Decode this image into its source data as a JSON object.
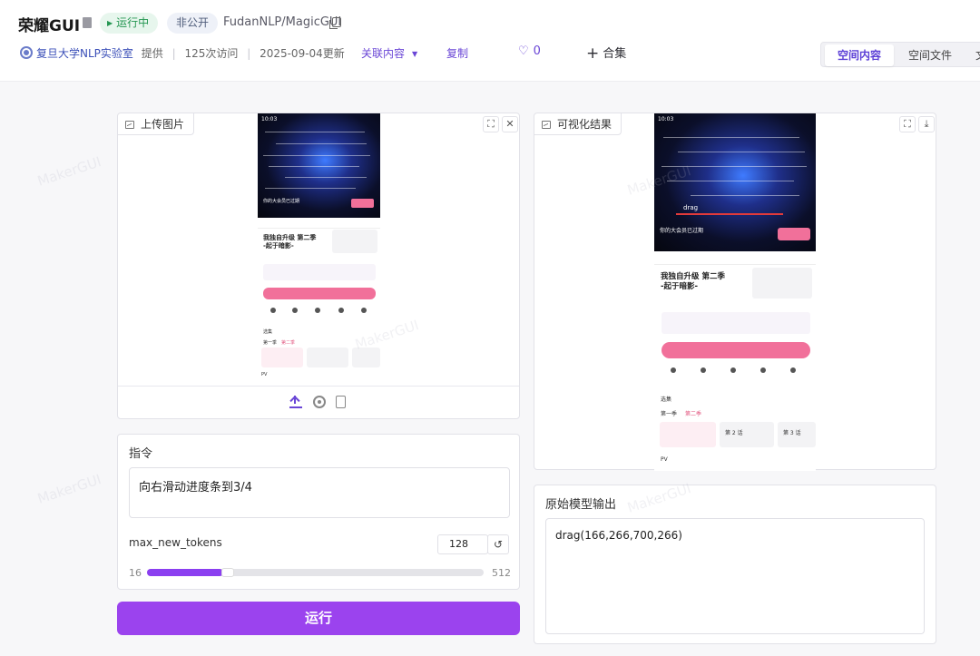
{
  "header": {
    "title": "荣耀GUI",
    "status_badge": "运行中",
    "visibility_badge": "非公开",
    "repo_path": "FudanNLP/MagicGUI",
    "org": "复旦大学NLP实验室",
    "provided": "提供",
    "visits": "125次访问",
    "updated": "2025-09-04更新",
    "related_label": "关联内容",
    "copy_label": "复制",
    "like_count": "0",
    "collection_label": "合集"
  },
  "tabs": [
    {
      "label": "空间内容",
      "active": true
    },
    {
      "label": "空间文件",
      "active": false
    },
    {
      "label": "文",
      "active": false
    }
  ],
  "upload_panel": {
    "label": "上传图片"
  },
  "result_panel": {
    "label": "可视化结果"
  },
  "instruction": {
    "label": "指令",
    "value": "向右滑动进度条到3/4"
  },
  "max_new_tokens": {
    "label": "max_new_tokens",
    "value": "128",
    "min": "16",
    "max": "512",
    "fraction": 0.226
  },
  "run_button": "运行",
  "raw_output": {
    "label": "原始模型输出",
    "value": "drag(166,266,700,266)"
  },
  "phone": {
    "time": "10:03",
    "show_title_1": "我独自升级 第二季",
    "show_title_2": "-起于暗影-",
    "drag_label": "drag",
    "select_label": "选集",
    "season_label": "第一季",
    "season2_label": "第二季",
    "episode2": "第 2 话",
    "episode3": "第 3 话",
    "member_text": "你的大会员已过期",
    "pv_label": "PV"
  },
  "watermark": "MakerGUI"
}
